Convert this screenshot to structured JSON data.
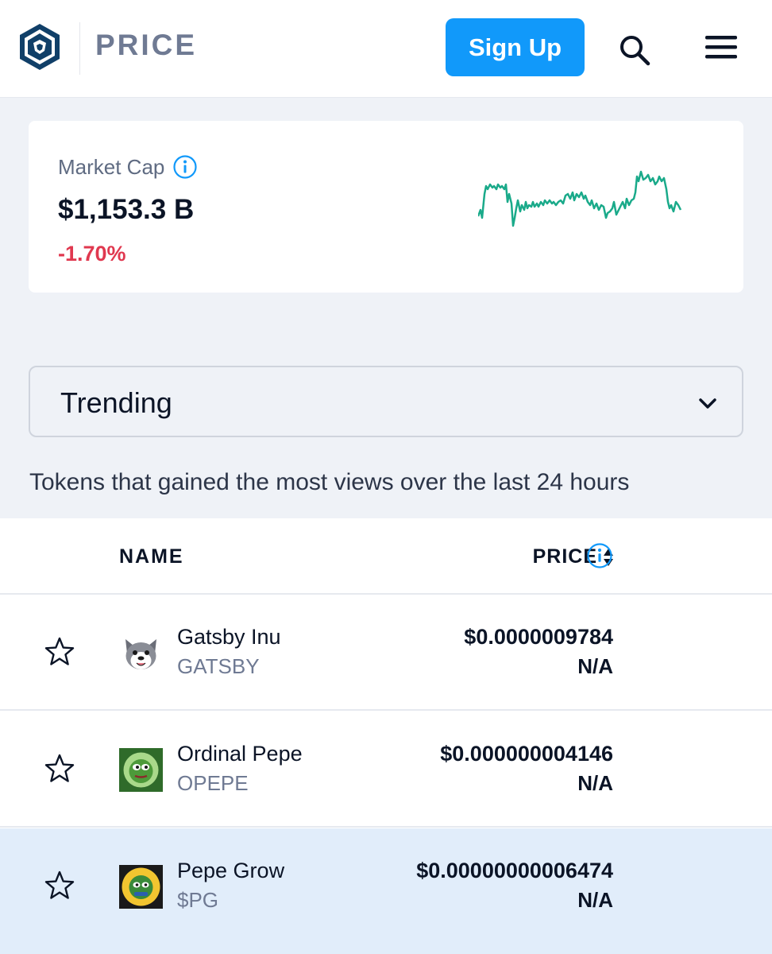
{
  "header": {
    "brand_text": "PRICE",
    "signup_label": "Sign Up",
    "colors": {
      "accent": "#1199fa",
      "logo": "#103f68"
    }
  },
  "market_cap": {
    "label": "Market Cap",
    "value": "$1,153.3 B",
    "change": "-1.70%",
    "change_color": "#e0384f",
    "sparkline_color": "#1aaa8a"
  },
  "filter": {
    "selected": "Trending",
    "description": "Tokens that gained the most views over the last 24 hours"
  },
  "table": {
    "columns": {
      "name": "NAME",
      "price": "PRICE"
    },
    "rows": [
      {
        "name": "Gatsby Inu",
        "symbol": "GATSBY",
        "price": "$0.0000009784",
        "change": "N/A",
        "icon": "gatsby-inu-logo",
        "highlighted": false
      },
      {
        "name": "Ordinal Pepe",
        "symbol": "OPEPE",
        "price": "$0.000000004146",
        "change": "N/A",
        "icon": "ordinal-pepe-logo",
        "highlighted": false
      },
      {
        "name": "Pepe Grow",
        "symbol": "$PG",
        "price": "$0.00000000006474",
        "change": "N/A",
        "icon": "pepe-grow-logo",
        "highlighted": true
      }
    ]
  }
}
